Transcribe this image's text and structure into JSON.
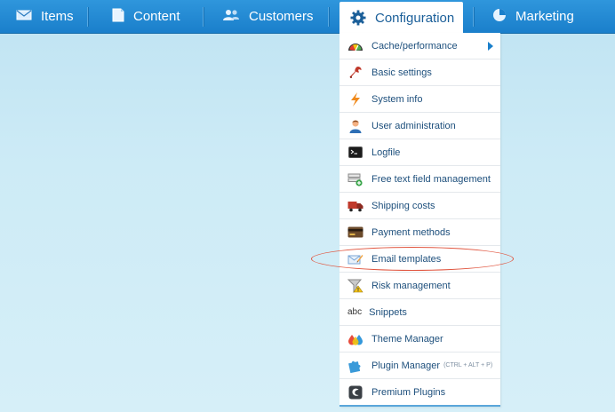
{
  "topnav": {
    "items": [
      {
        "label": "Items",
        "icon": "mail-icon"
      },
      {
        "label": "Content",
        "icon": "page-icon"
      },
      {
        "label": "Customers",
        "icon": "users-icon"
      },
      {
        "label": "Configuration",
        "icon": "gear-icon"
      },
      {
        "label": "Marketing",
        "icon": "pie-chart-icon"
      }
    ],
    "active": "Configuration",
    "accent_color": "#1a7fcb"
  },
  "dropdown": {
    "items": [
      {
        "label": "Cache/performance",
        "icon": "speedometer-icon",
        "has_submenu": true
      },
      {
        "label": "Basic settings",
        "icon": "wrench-icon"
      },
      {
        "label": "System info",
        "icon": "lightning-icon"
      },
      {
        "label": "User administration",
        "icon": "user-icon"
      },
      {
        "label": "Logfile",
        "icon": "terminal-icon"
      },
      {
        "label": "Free text field management",
        "icon": "field-add-icon"
      },
      {
        "label": "Shipping costs",
        "icon": "truck-icon"
      },
      {
        "label": "Payment methods",
        "icon": "credit-card-icon"
      },
      {
        "label": "Email templates",
        "icon": "envelope-pencil-icon",
        "highlighted": true
      },
      {
        "label": "Risk management",
        "icon": "funnel-warning-icon"
      },
      {
        "label": "Snippets",
        "icon": "abc-icon",
        "icon_text": "abc"
      },
      {
        "label": "Theme Manager",
        "icon": "color-drops-icon"
      },
      {
        "label": "Plugin Manager",
        "icon": "puzzle-icon",
        "shortcut": "(CTRL + ALT + P)"
      },
      {
        "label": "Premium Plugins",
        "icon": "shopware-logo-icon"
      }
    ],
    "highlight_color": "#e0553f"
  }
}
